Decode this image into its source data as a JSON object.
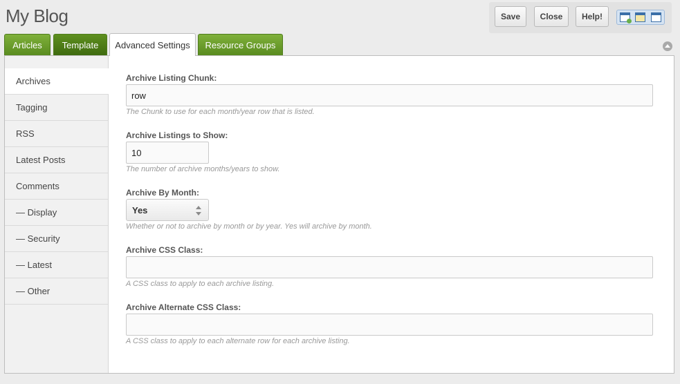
{
  "header": {
    "title": "My Blog"
  },
  "toolbar": {
    "save_label": "Save",
    "close_label": "Close",
    "help_label": "Help!",
    "view_icons": [
      "new-panel-icon",
      "edit-panel-icon",
      "layout-panel-icon"
    ]
  },
  "tabs": [
    {
      "label": "Articles",
      "active": false
    },
    {
      "label": "Template",
      "active": false
    },
    {
      "label": "Advanced Settings",
      "active": true
    },
    {
      "label": "Resource Groups",
      "active": false
    }
  ],
  "sidebar": {
    "items": [
      {
        "label": "Archives",
        "active": true
      },
      {
        "label": "Tagging",
        "active": false
      },
      {
        "label": "RSS",
        "active": false
      },
      {
        "label": "Latest Posts",
        "active": false
      },
      {
        "label": "Comments",
        "active": false
      },
      {
        "label": "— Display",
        "active": false
      },
      {
        "label": "— Security",
        "active": false
      },
      {
        "label": "— Latest",
        "active": false
      },
      {
        "label": "— Other",
        "active": false
      }
    ]
  },
  "form": {
    "fields": [
      {
        "label": "Archive Listing Chunk:",
        "value": "row",
        "description": "The Chunk to use for each month/year row that is listed."
      },
      {
        "label": "Archive Listings to Show:",
        "value": "10",
        "description": "The number of archive months/years to show."
      },
      {
        "label": "Archive By Month:",
        "value": "Yes",
        "description": "Whether or not to archive by month or by year. Yes will archive by month."
      },
      {
        "label": "Archive CSS Class:",
        "value": "",
        "description": "A CSS class to apply to each archive listing."
      },
      {
        "label": "Archive Alternate CSS Class:",
        "value": "",
        "description": "A CSS class to apply to each alternate row for each archive listing."
      }
    ]
  },
  "colors": {
    "tab_green": "#6a9e2c",
    "accent_blue": "#3b6fa8"
  }
}
